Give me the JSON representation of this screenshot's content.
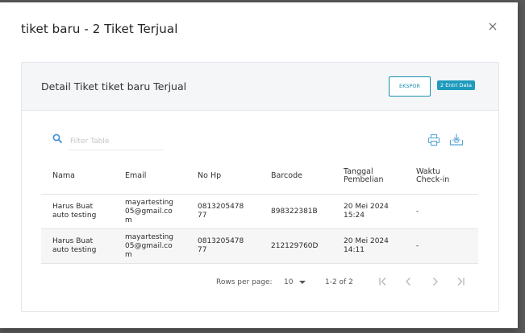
{
  "modal": {
    "title": "tiket baru - 2 Tiket Terjual",
    "close_label": "×"
  },
  "card": {
    "title": "Detail Tiket tiket baru Terjual",
    "export_label": "EKSPOR",
    "entry_badge": "2 Entri Data"
  },
  "toolbar": {
    "filter_placeholder": "Filter Table",
    "icons": [
      "search-icon",
      "print-icon",
      "download-icon"
    ]
  },
  "table": {
    "headers": {
      "name": "Nama",
      "email": "Email",
      "phone": "No Hp",
      "barcode": "Barcode",
      "date_l1": "Tanggal",
      "date_l2": "Pembelian",
      "checkin_l1": "Waktu",
      "checkin_l2": "Check-in"
    },
    "rows": [
      {
        "name_l1": "Harus Buat",
        "name_l2": "auto testing",
        "email_l1": "mayartesting",
        "email_l2": "05@gmail.co",
        "email_l3": "m",
        "phone_l1": "0813205478",
        "phone_l2": "77",
        "barcode": "898322381B",
        "date_l1": "20 Mei 2024",
        "date_l2": "15:24",
        "checkin": "-"
      },
      {
        "name_l1": "Harus Buat",
        "name_l2": "auto testing",
        "email_l1": "mayartesting",
        "email_l2": "05@gmail.co",
        "email_l3": "m",
        "phone_l1": "0813205478",
        "phone_l2": "77",
        "barcode": "212129760D",
        "date_l1": "20 Mei 2024",
        "date_l2": "14:11",
        "checkin": "-"
      }
    ]
  },
  "pagination": {
    "rows_per_page_label": "Rows per page:",
    "rows_per_page_value": "10",
    "range": "1-2 of 2",
    "icons": [
      "first-page-icon",
      "prev-page-icon",
      "next-page-icon",
      "last-page-icon"
    ]
  },
  "colors": {
    "accent": "#1b8fb0",
    "badge": "#1f9bbd",
    "icon": "#5aa6d6"
  }
}
